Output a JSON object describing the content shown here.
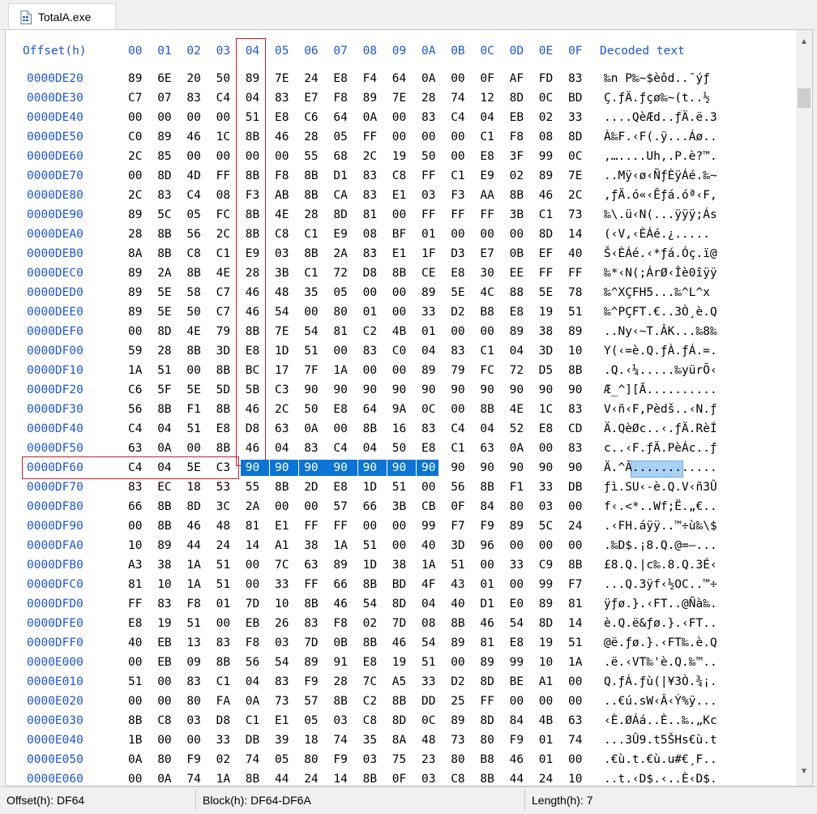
{
  "tab": {
    "title": "TotalA.exe",
    "icon": "exe-file-icon"
  },
  "header": {
    "offset_label": "Offset(h)",
    "columns": [
      "00",
      "01",
      "02",
      "03",
      "04",
      "05",
      "06",
      "07",
      "08",
      "09",
      "0A",
      "0B",
      "0C",
      "0D",
      "0E",
      "0F"
    ],
    "decoded_label": "Decoded text"
  },
  "rows": [
    {
      "offset": "0000DE20",
      "bytes": [
        "89",
        "6E",
        "20",
        "50",
        "89",
        "7E",
        "24",
        "E8",
        "F4",
        "64",
        "0A",
        "00",
        "0F",
        "AF",
        "FD",
        "83"
      ],
      "text": "‰n P‰~$èôd..¯ýƒ"
    },
    {
      "offset": "0000DE30",
      "bytes": [
        "C7",
        "07",
        "83",
        "C4",
        "04",
        "83",
        "E7",
        "F8",
        "89",
        "7E",
        "28",
        "74",
        "12",
        "8D",
        "0C",
        "BD"
      ],
      "text": "Ç.ƒÄ.ƒçø‰~(t..½"
    },
    {
      "offset": "0000DE40",
      "bytes": [
        "00",
        "00",
        "00",
        "00",
        "51",
        "E8",
        "C6",
        "64",
        "0A",
        "00",
        "83",
        "C4",
        "04",
        "EB",
        "02",
        "33"
      ],
      "text": "....QèÆd..ƒÄ.ë.3"
    },
    {
      "offset": "0000DE50",
      "bytes": [
        "C0",
        "89",
        "46",
        "1C",
        "8B",
        "46",
        "28",
        "05",
        "FF",
        "00",
        "00",
        "00",
        "C1",
        "F8",
        "08",
        "8D"
      ],
      "text": "À‰F.‹F(.ÿ...Áø.."
    },
    {
      "offset": "0000DE60",
      "bytes": [
        "2C",
        "85",
        "00",
        "00",
        "00",
        "00",
        "55",
        "68",
        "2C",
        "19",
        "50",
        "00",
        "E8",
        "3F",
        "99",
        "0C"
      ],
      "text": ",…....Uh,.P.è?™."
    },
    {
      "offset": "0000DE70",
      "bytes": [
        "00",
        "8D",
        "4D",
        "FF",
        "8B",
        "F8",
        "8B",
        "D1",
        "83",
        "C8",
        "FF",
        "C1",
        "E9",
        "02",
        "89",
        "7E"
      ],
      "text": "..Mÿ‹ø‹ÑƒÈÿÁé.‰~"
    },
    {
      "offset": "0000DE80",
      "bytes": [
        "2C",
        "83",
        "C4",
        "08",
        "F3",
        "AB",
        "8B",
        "CA",
        "83",
        "E1",
        "03",
        "F3",
        "AA",
        "8B",
        "46",
        "2C"
      ],
      "text": ",ƒÄ.ó«‹Êƒá.óª‹F,"
    },
    {
      "offset": "0000DE90",
      "bytes": [
        "89",
        "5C",
        "05",
        "FC",
        "8B",
        "4E",
        "28",
        "8D",
        "81",
        "00",
        "FF",
        "FF",
        "FF",
        "3B",
        "C1",
        "73"
      ],
      "text": "‰\\.ü‹N(...ÿÿÿ;Ás"
    },
    {
      "offset": "0000DEA0",
      "bytes": [
        "28",
        "8B",
        "56",
        "2C",
        "8B",
        "C8",
        "C1",
        "E9",
        "08",
        "BF",
        "01",
        "00",
        "00",
        "00",
        "8D",
        "14"
      ],
      "text": "(‹V,‹ÈÁé.¿....."
    },
    {
      "offset": "0000DEB0",
      "bytes": [
        "8A",
        "8B",
        "C8",
        "C1",
        "E9",
        "03",
        "8B",
        "2A",
        "83",
        "E1",
        "1F",
        "D3",
        "E7",
        "0B",
        "EF",
        "40"
      ],
      "text": "Š‹ÈÁé.‹*ƒá.Óç.ï@"
    },
    {
      "offset": "0000DEC0",
      "bytes": [
        "89",
        "2A",
        "8B",
        "4E",
        "28",
        "3B",
        "C1",
        "72",
        "D8",
        "8B",
        "CE",
        "E8",
        "30",
        "EE",
        "FF",
        "FF"
      ],
      "text": "‰*‹N(;ÁrØ‹Îè0îÿÿ"
    },
    {
      "offset": "0000DED0",
      "bytes": [
        "89",
        "5E",
        "58",
        "C7",
        "46",
        "48",
        "35",
        "05",
        "00",
        "00",
        "89",
        "5E",
        "4C",
        "88",
        "5E",
        "78"
      ],
      "text": "‰^XÇFH5...‰^L^x"
    },
    {
      "offset": "0000DEE0",
      "bytes": [
        "89",
        "5E",
        "50",
        "C7",
        "46",
        "54",
        "00",
        "80",
        "01",
        "00",
        "33",
        "D2",
        "B8",
        "E8",
        "19",
        "51"
      ],
      "text": "‰^PÇFT.€..3Ò¸è.Q"
    },
    {
      "offset": "0000DEF0",
      "bytes": [
        "00",
        "8D",
        "4E",
        "79",
        "8B",
        "7E",
        "54",
        "81",
        "C2",
        "4B",
        "01",
        "00",
        "00",
        "89",
        "38",
        "89"
      ],
      "text": "..Ny‹~T.ÂK...‰8‰"
    },
    {
      "offset": "0000DF00",
      "bytes": [
        "59",
        "28",
        "8B",
        "3D",
        "E8",
        "1D",
        "51",
        "00",
        "83",
        "C0",
        "04",
        "83",
        "C1",
        "04",
        "3D",
        "10"
      ],
      "text": "Y(‹=è.Q.ƒÀ.ƒÁ.=."
    },
    {
      "offset": "0000DF10",
      "bytes": [
        "1A",
        "51",
        "00",
        "8B",
        "BC",
        "17",
        "7F",
        "1A",
        "00",
        "00",
        "89",
        "79",
        "FC",
        "72",
        "D5",
        "8B"
      ],
      "text": ".Q.‹¼.....‰yürÕ‹"
    },
    {
      "offset": "0000DF20",
      "bytes": [
        "C6",
        "5F",
        "5E",
        "5D",
        "5B",
        "C3",
        "90",
        "90",
        "90",
        "90",
        "90",
        "90",
        "90",
        "90",
        "90",
        "90"
      ],
      "text": "Æ_^][Ã.........."
    },
    {
      "offset": "0000DF30",
      "bytes": [
        "56",
        "8B",
        "F1",
        "8B",
        "46",
        "2C",
        "50",
        "E8",
        "64",
        "9A",
        "0C",
        "00",
        "8B",
        "4E",
        "1C",
        "83"
      ],
      "text": "V‹ñ‹F,Pèdš..‹N.ƒ"
    },
    {
      "offset": "0000DF40",
      "bytes": [
        "C4",
        "04",
        "51",
        "E8",
        "D8",
        "63",
        "0A",
        "00",
        "8B",
        "16",
        "83",
        "C4",
        "04",
        "52",
        "E8",
        "CD"
      ],
      "text": "Ä.QèØc..‹.ƒÄ.RèÍ"
    },
    {
      "offset": "0000DF50",
      "bytes": [
        "63",
        "0A",
        "00",
        "8B",
        "46",
        "04",
        "83",
        "C4",
        "04",
        "50",
        "E8",
        "C1",
        "63",
        "0A",
        "00",
        "83"
      ],
      "text": "c..‹F.ƒÄ.PèÁc..ƒ"
    },
    {
      "offset": "0000DF60",
      "bytes": [
        "C4",
        "04",
        "5E",
        "C3",
        "90",
        "90",
        "90",
        "90",
        "90",
        "90",
        "90",
        "90",
        "90",
        "90",
        "90",
        "90"
      ],
      "text": "Ä.^Ã............"
    },
    {
      "offset": "0000DF70",
      "bytes": [
        "83",
        "EC",
        "18",
        "53",
        "55",
        "8B",
        "2D",
        "E8",
        "1D",
        "51",
        "00",
        "56",
        "8B",
        "F1",
        "33",
        "DB"
      ],
      "text": "ƒì.SU‹-è.Q.V‹ñ3Û"
    },
    {
      "offset": "0000DF80",
      "bytes": [
        "66",
        "8B",
        "8D",
        "3C",
        "2A",
        "00",
        "00",
        "57",
        "66",
        "3B",
        "CB",
        "0F",
        "84",
        "80",
        "03",
        "00"
      ],
      "text": "f‹.<*..Wf;Ë.„€.."
    },
    {
      "offset": "0000DF90",
      "bytes": [
        "00",
        "8B",
        "46",
        "48",
        "81",
        "E1",
        "FF",
        "FF",
        "00",
        "00",
        "99",
        "F7",
        "F9",
        "89",
        "5C",
        "24"
      ],
      "text": ".‹FH.áÿÿ..™÷ù‰\\$"
    },
    {
      "offset": "0000DFA0",
      "bytes": [
        "10",
        "89",
        "44",
        "24",
        "14",
        "A1",
        "38",
        "1A",
        "51",
        "00",
        "40",
        "3D",
        "96",
        "00",
        "00",
        "00"
      ],
      "text": ".‰D$.¡8.Q.@=–..."
    },
    {
      "offset": "0000DFB0",
      "bytes": [
        "A3",
        "38",
        "1A",
        "51",
        "00",
        "7C",
        "63",
        "89",
        "1D",
        "38",
        "1A",
        "51",
        "00",
        "33",
        "C9",
        "8B"
      ],
      "text": "£8.Q.|c‰.8.Q.3É‹"
    },
    {
      "offset": "0000DFC0",
      "bytes": [
        "81",
        "10",
        "1A",
        "51",
        "00",
        "33",
        "FF",
        "66",
        "8B",
        "BD",
        "4F",
        "43",
        "01",
        "00",
        "99",
        "F7"
      ],
      "text": "...Q.3ÿf‹½OC..™÷"
    },
    {
      "offset": "0000DFD0",
      "bytes": [
        "FF",
        "83",
        "F8",
        "01",
        "7D",
        "10",
        "8B",
        "46",
        "54",
        "8D",
        "04",
        "40",
        "D1",
        "E0",
        "89",
        "81"
      ],
      "text": "ÿƒø.}.‹FT..@Ñà‰."
    },
    {
      "offset": "0000DFE0",
      "bytes": [
        "E8",
        "19",
        "51",
        "00",
        "EB",
        "26",
        "83",
        "F8",
        "02",
        "7D",
        "08",
        "8B",
        "46",
        "54",
        "8D",
        "14"
      ],
      "text": "è.Q.ë&ƒø.}.‹FT.."
    },
    {
      "offset": "0000DFF0",
      "bytes": [
        "40",
        "EB",
        "13",
        "83",
        "F8",
        "03",
        "7D",
        "0B",
        "8B",
        "46",
        "54",
        "89",
        "81",
        "E8",
        "19",
        "51"
      ],
      "text": "@ë.ƒø.}.‹FT‰.è.Q"
    },
    {
      "offset": "0000E000",
      "bytes": [
        "00",
        "EB",
        "09",
        "8B",
        "56",
        "54",
        "89",
        "91",
        "E8",
        "19",
        "51",
        "00",
        "89",
        "99",
        "10",
        "1A"
      ],
      "text": ".ë.‹VT‰'è.Q.‰™.."
    },
    {
      "offset": "0000E010",
      "bytes": [
        "51",
        "00",
        "83",
        "C1",
        "04",
        "83",
        "F9",
        "28",
        "7C",
        "A5",
        "33",
        "D2",
        "8D",
        "BE",
        "A1",
        "00"
      ],
      "text": "Q.ƒÁ.ƒù(|¥3Ò.¾¡."
    },
    {
      "offset": "0000E020",
      "bytes": [
        "00",
        "00",
        "80",
        "FA",
        "0A",
        "73",
        "57",
        "8B",
        "C2",
        "8B",
        "DD",
        "25",
        "FF",
        "00",
        "00",
        "00"
      ],
      "text": "..€ú.sW‹Â‹Ý%ÿ..."
    },
    {
      "offset": "0000E030",
      "bytes": [
        "8B",
        "C8",
        "03",
        "D8",
        "C1",
        "E1",
        "05",
        "03",
        "C8",
        "8D",
        "0C",
        "89",
        "8D",
        "84",
        "4B",
        "63"
      ],
      "text": "‹È.ØÁá..È..‰.„Kc"
    },
    {
      "offset": "0000E040",
      "bytes": [
        "1B",
        "00",
        "00",
        "33",
        "DB",
        "39",
        "18",
        "74",
        "35",
        "8A",
        "48",
        "73",
        "80",
        "F9",
        "01",
        "74"
      ],
      "text": "...3Û9.t5ŠHs€ù.t"
    },
    {
      "offset": "0000E050",
      "bytes": [
        "0A",
        "80",
        "F9",
        "02",
        "74",
        "05",
        "80",
        "F9",
        "03",
        "75",
        "23",
        "80",
        "B8",
        "46",
        "01",
        "00"
      ],
      "text": ".€ù.t.€ù.u#€¸F.."
    },
    {
      "offset": "0000E060",
      "bytes": [
        "00",
        "0A",
        "74",
        "1A",
        "8B",
        "44",
        "24",
        "14",
        "8B",
        "0F",
        "03",
        "C8",
        "8B",
        "44",
        "24",
        "10"
      ],
      "text": "..t.‹D$.‹..È‹D$."
    }
  ],
  "selection": {
    "row": 20,
    "from": 4,
    "to": 10
  },
  "status": {
    "offset": "Offset(h): DF64",
    "block": "Block(h): DF64-DF6A",
    "length": "Length(h): 7"
  },
  "colors": {
    "offset_text": "#1e56d4",
    "selection": "#0b74d4",
    "decoded_selection": "#a9d2f3",
    "highlight_box": "#c0202b"
  }
}
